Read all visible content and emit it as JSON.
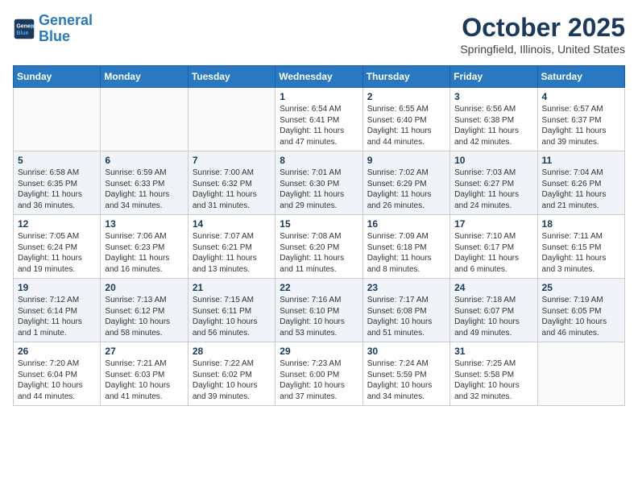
{
  "header": {
    "logo_line1": "General",
    "logo_line2": "Blue",
    "month": "October 2025",
    "location": "Springfield, Illinois, United States"
  },
  "weekdays": [
    "Sunday",
    "Monday",
    "Tuesday",
    "Wednesday",
    "Thursday",
    "Friday",
    "Saturday"
  ],
  "rows": [
    [
      {
        "day": "",
        "info": ""
      },
      {
        "day": "",
        "info": ""
      },
      {
        "day": "",
        "info": ""
      },
      {
        "day": "1",
        "info": "Sunrise: 6:54 AM\nSunset: 6:41 PM\nDaylight: 11 hours\nand 47 minutes."
      },
      {
        "day": "2",
        "info": "Sunrise: 6:55 AM\nSunset: 6:40 PM\nDaylight: 11 hours\nand 44 minutes."
      },
      {
        "day": "3",
        "info": "Sunrise: 6:56 AM\nSunset: 6:38 PM\nDaylight: 11 hours\nand 42 minutes."
      },
      {
        "day": "4",
        "info": "Sunrise: 6:57 AM\nSunset: 6:37 PM\nDaylight: 11 hours\nand 39 minutes."
      }
    ],
    [
      {
        "day": "5",
        "info": "Sunrise: 6:58 AM\nSunset: 6:35 PM\nDaylight: 11 hours\nand 36 minutes."
      },
      {
        "day": "6",
        "info": "Sunrise: 6:59 AM\nSunset: 6:33 PM\nDaylight: 11 hours\nand 34 minutes."
      },
      {
        "day": "7",
        "info": "Sunrise: 7:00 AM\nSunset: 6:32 PM\nDaylight: 11 hours\nand 31 minutes."
      },
      {
        "day": "8",
        "info": "Sunrise: 7:01 AM\nSunset: 6:30 PM\nDaylight: 11 hours\nand 29 minutes."
      },
      {
        "day": "9",
        "info": "Sunrise: 7:02 AM\nSunset: 6:29 PM\nDaylight: 11 hours\nand 26 minutes."
      },
      {
        "day": "10",
        "info": "Sunrise: 7:03 AM\nSunset: 6:27 PM\nDaylight: 11 hours\nand 24 minutes."
      },
      {
        "day": "11",
        "info": "Sunrise: 7:04 AM\nSunset: 6:26 PM\nDaylight: 11 hours\nand 21 minutes."
      }
    ],
    [
      {
        "day": "12",
        "info": "Sunrise: 7:05 AM\nSunset: 6:24 PM\nDaylight: 11 hours\nand 19 minutes."
      },
      {
        "day": "13",
        "info": "Sunrise: 7:06 AM\nSunset: 6:23 PM\nDaylight: 11 hours\nand 16 minutes."
      },
      {
        "day": "14",
        "info": "Sunrise: 7:07 AM\nSunset: 6:21 PM\nDaylight: 11 hours\nand 13 minutes."
      },
      {
        "day": "15",
        "info": "Sunrise: 7:08 AM\nSunset: 6:20 PM\nDaylight: 11 hours\nand 11 minutes."
      },
      {
        "day": "16",
        "info": "Sunrise: 7:09 AM\nSunset: 6:18 PM\nDaylight: 11 hours\nand 8 minutes."
      },
      {
        "day": "17",
        "info": "Sunrise: 7:10 AM\nSunset: 6:17 PM\nDaylight: 11 hours\nand 6 minutes."
      },
      {
        "day": "18",
        "info": "Sunrise: 7:11 AM\nSunset: 6:15 PM\nDaylight: 11 hours\nand 3 minutes."
      }
    ],
    [
      {
        "day": "19",
        "info": "Sunrise: 7:12 AM\nSunset: 6:14 PM\nDaylight: 11 hours\nand 1 minute."
      },
      {
        "day": "20",
        "info": "Sunrise: 7:13 AM\nSunset: 6:12 PM\nDaylight: 10 hours\nand 58 minutes."
      },
      {
        "day": "21",
        "info": "Sunrise: 7:15 AM\nSunset: 6:11 PM\nDaylight: 10 hours\nand 56 minutes."
      },
      {
        "day": "22",
        "info": "Sunrise: 7:16 AM\nSunset: 6:10 PM\nDaylight: 10 hours\nand 53 minutes."
      },
      {
        "day": "23",
        "info": "Sunrise: 7:17 AM\nSunset: 6:08 PM\nDaylight: 10 hours\nand 51 minutes."
      },
      {
        "day": "24",
        "info": "Sunrise: 7:18 AM\nSunset: 6:07 PM\nDaylight: 10 hours\nand 49 minutes."
      },
      {
        "day": "25",
        "info": "Sunrise: 7:19 AM\nSunset: 6:05 PM\nDaylight: 10 hours\nand 46 minutes."
      }
    ],
    [
      {
        "day": "26",
        "info": "Sunrise: 7:20 AM\nSunset: 6:04 PM\nDaylight: 10 hours\nand 44 minutes."
      },
      {
        "day": "27",
        "info": "Sunrise: 7:21 AM\nSunset: 6:03 PM\nDaylight: 10 hours\nand 41 minutes."
      },
      {
        "day": "28",
        "info": "Sunrise: 7:22 AM\nSunset: 6:02 PM\nDaylight: 10 hours\nand 39 minutes."
      },
      {
        "day": "29",
        "info": "Sunrise: 7:23 AM\nSunset: 6:00 PM\nDaylight: 10 hours\nand 37 minutes."
      },
      {
        "day": "30",
        "info": "Sunrise: 7:24 AM\nSunset: 5:59 PM\nDaylight: 10 hours\nand 34 minutes."
      },
      {
        "day": "31",
        "info": "Sunrise: 7:25 AM\nSunset: 5:58 PM\nDaylight: 10 hours\nand 32 minutes."
      },
      {
        "day": "",
        "info": ""
      }
    ]
  ]
}
